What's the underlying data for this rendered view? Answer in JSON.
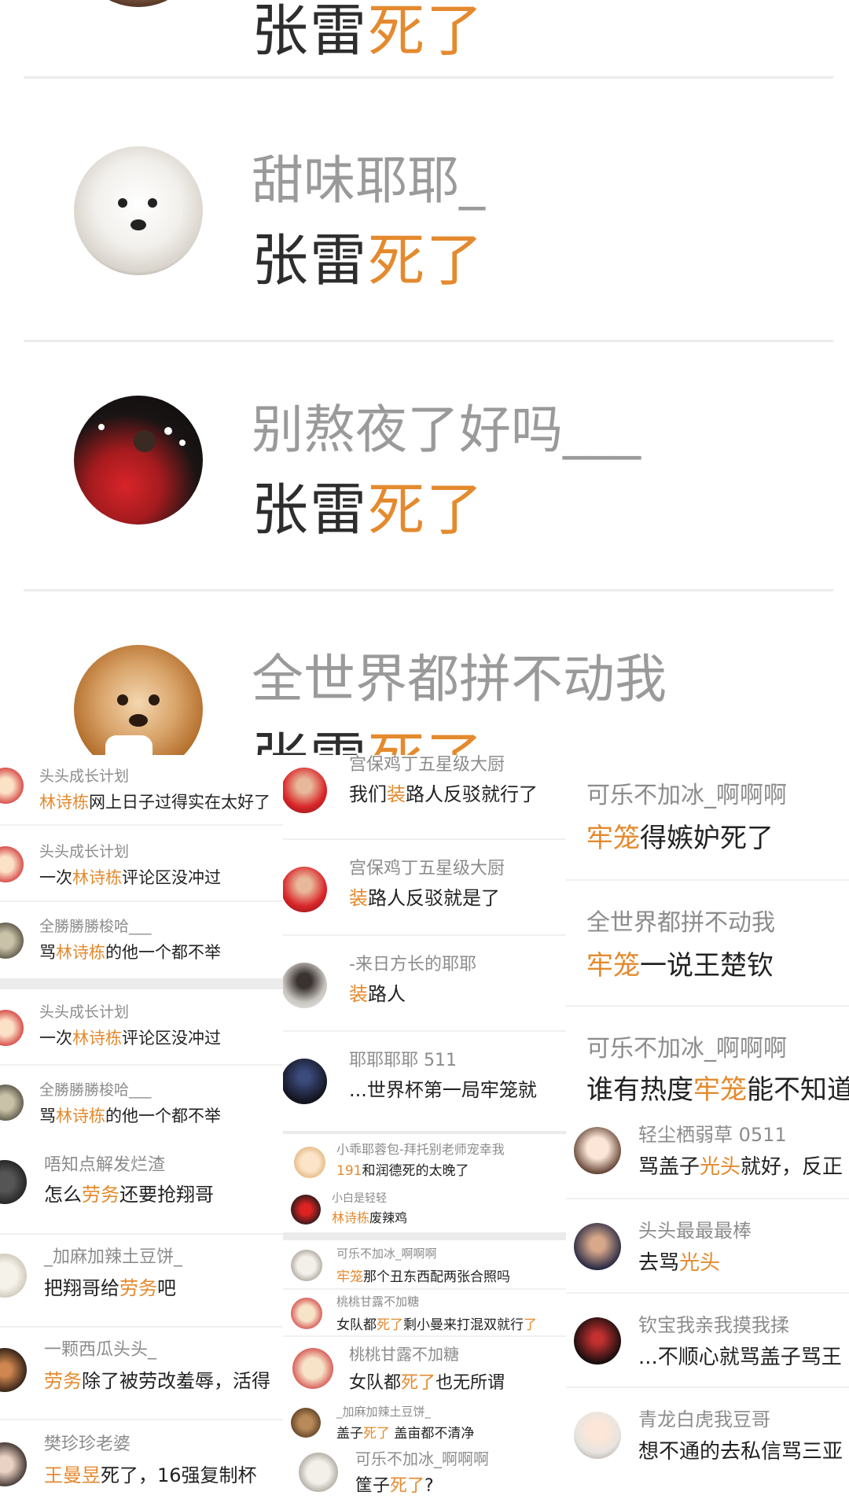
{
  "top": {
    "rows": [
      {
        "name": "",
        "text_a": "张雷",
        "text_b": "死了"
      },
      {
        "name": "甜味耶耶_",
        "text_a": "张雷",
        "text_b": "死了"
      },
      {
        "name": "别熬夜了好吗___",
        "text_a": "张雷",
        "text_b": "死了"
      },
      {
        "name": "全世界都拼不动我",
        "text_a": "张雷",
        "text_b": "死了"
      }
    ]
  },
  "col1": {
    "items": [
      {
        "name": "头头成长计划",
        "t": [
          [
            "林诗栋",
            true
          ],
          [
            "网上日子过得实在太好了",
            false
          ]
        ]
      },
      {
        "name": "头头成长计划",
        "t": [
          [
            "一次",
            false
          ],
          [
            "林诗栋",
            true
          ],
          [
            "评论区没冲过",
            false
          ]
        ]
      },
      {
        "name": "全勝勝勝梭哈___",
        "t": [
          [
            "骂",
            false
          ],
          [
            "林诗栋",
            true
          ],
          [
            "的他一个都不举",
            false
          ]
        ]
      },
      {
        "name": "头头成长计划",
        "t": [
          [
            "一次",
            false
          ],
          [
            "林诗栋",
            true
          ],
          [
            "评论区没冲过",
            false
          ]
        ]
      },
      {
        "name": "全勝勝勝梭哈___",
        "t": [
          [
            "骂",
            false
          ],
          [
            "林诗栋",
            true
          ],
          [
            "的他一个都不举",
            false
          ]
        ]
      },
      {
        "name": "唔知点解发烂渣",
        "t": [
          [
            "怎么",
            false
          ],
          [
            "劳务",
            true
          ],
          [
            "还要抢翔哥",
            false
          ]
        ]
      },
      {
        "name": "_加麻加辣土豆饼_",
        "t": [
          [
            "把翔哥给",
            false
          ],
          [
            "劳务",
            true
          ],
          [
            "吧",
            false
          ]
        ]
      },
      {
        "name": "一颗西瓜头头_",
        "t": [
          [
            "劳务",
            true
          ],
          [
            "除了被劳改羞辱，活得",
            false
          ]
        ]
      },
      {
        "name": "樊珍珍老婆",
        "t": [
          [
            "王曼昱",
            true
          ],
          [
            "死了，16强复制杯",
            false
          ]
        ]
      }
    ]
  },
  "col2": {
    "items": [
      {
        "name": "宫保鸡丁五星级大厨",
        "t": [
          [
            "我们",
            false
          ],
          [
            "装",
            true
          ],
          [
            "路人反驳就行了",
            false
          ]
        ]
      },
      {
        "name": "宫保鸡丁五星级大厨",
        "t": [
          [
            "装",
            true
          ],
          [
            "路人反驳就是了",
            false
          ]
        ]
      },
      {
        "name": "-来日方长的耶耶",
        "t": [
          [
            "装",
            true
          ],
          [
            "路人",
            false
          ]
        ]
      },
      {
        "name": "耶耶耶耶 511",
        "t": [
          [
            "...世界杯第一局牢笼就",
            false
          ]
        ]
      },
      {
        "name": "小乖耶蓉包-拜托别老师宠幸我",
        "t": [
          [
            "191",
            true
          ],
          [
            "和润德死的太晚了",
            false
          ]
        ]
      },
      {
        "name": "小白是轻轻",
        "t": [
          [
            "林诗栋",
            true
          ],
          [
            "废辣鸡",
            false
          ]
        ]
      },
      {
        "name": "可乐不加冰_啊啊啊",
        "t": [
          [
            "牢笼",
            true
          ],
          [
            "那个丑东西配两张合照吗",
            false
          ]
        ]
      },
      {
        "name": "桃桃甘露不加糖",
        "t": [
          [
            "女队都",
            false
          ],
          [
            "死了",
            true
          ],
          [
            "剩小曼来打混双就行",
            false
          ],
          [
            "了",
            true
          ]
        ]
      },
      {
        "name": "桃桃甘露不加糖",
        "t": [
          [
            "女队都",
            false
          ],
          [
            "死了",
            true
          ],
          [
            "也无所谓",
            false
          ]
        ]
      },
      {
        "name": "_加麻加辣土豆饼_",
        "t": [
          [
            "盖子",
            false
          ],
          [
            "死了",
            true
          ],
          [
            " 盖亩都不清净",
            false
          ]
        ]
      },
      {
        "name": "可乐不加冰_啊啊啊",
        "t": [
          [
            "筐子",
            false
          ],
          [
            "死了",
            true
          ],
          [
            "?",
            false
          ]
        ]
      }
    ]
  },
  "col3": {
    "items": [
      {
        "name": "可乐不加冰_啊啊啊",
        "t": [
          [
            "牢笼",
            true
          ],
          [
            "得嫉妒死了",
            false
          ]
        ]
      },
      {
        "name": "全世界都拼不动我",
        "t": [
          [
            "牢笼",
            true
          ],
          [
            "一说王楚钦",
            false
          ]
        ]
      },
      {
        "name": "可乐不加冰_啊啊啊",
        "t": [
          [
            "谁有热度",
            false
          ],
          [
            "牢笼",
            true
          ],
          [
            "能不知道",
            false
          ]
        ]
      },
      {
        "name": "轻尘栖弱草 0511",
        "t": [
          [
            "骂盖子",
            false
          ],
          [
            "光头",
            true
          ],
          [
            "就好，反正",
            false
          ]
        ]
      },
      {
        "name": "头头最最最棒",
        "t": [
          [
            "去骂",
            false
          ],
          [
            "光头",
            true
          ]
        ]
      },
      {
        "name": "钦宝我亲我摸我揉",
        "t": [
          [
            "...不顺心就骂盖子骂王",
            false
          ]
        ]
      },
      {
        "name": "青龙白虎我豆哥",
        "t": [
          [
            "想不通的去私信骂三亚",
            false
          ]
        ]
      }
    ]
  },
  "icons": [
    "avatar-icon"
  ]
}
